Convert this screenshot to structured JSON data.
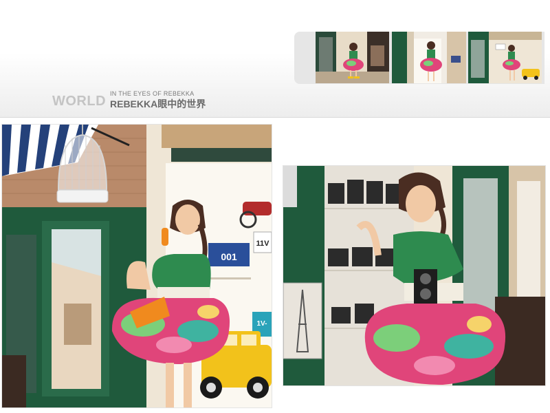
{
  "header": {
    "logo_word": "WORLD",
    "logo_tagline": "IN THE EYES OF REBEKKA",
    "logo_brand": "REBEKKA眼中的世界"
  },
  "thumbnails": [
    {
      "name": "thumbnail-1",
      "selected": false
    },
    {
      "name": "thumbnail-2",
      "selected": false
    },
    {
      "name": "thumbnail-3",
      "selected": false
    }
  ],
  "photo_left": {
    "plates": [
      "001",
      "11V",
      "1V-"
    ]
  },
  "colors": {
    "door_green": "#1f5a3c",
    "dress_green": "#2e8b4f",
    "skirt_pink": "#e0457a",
    "car_yellow": "#f2c21b",
    "wall_cream": "#efe6d6"
  }
}
